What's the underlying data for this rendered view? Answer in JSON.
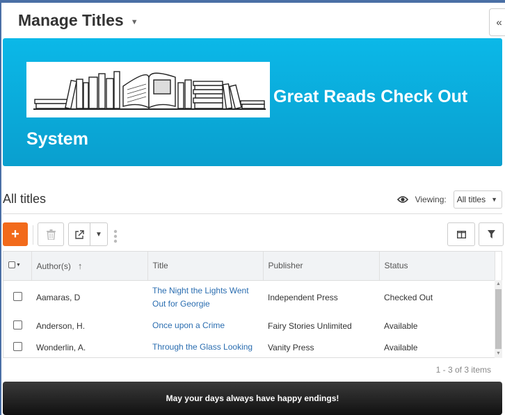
{
  "header": {
    "title": "Manage Titles"
  },
  "banner": {
    "text": "Great Reads Check Out System",
    "colors": {
      "background": "#0bb8e8"
    }
  },
  "list": {
    "title": "All titles",
    "viewing_label": "Viewing:",
    "viewing_value": "All titles"
  },
  "toolbar": {
    "add_label": "+",
    "colors": {
      "add_background": "#f26a1b"
    }
  },
  "grid": {
    "columns": [
      "Author(s)",
      "Title",
      "Publisher",
      "Status"
    ],
    "rows": [
      {
        "author": "Aamaras, D",
        "title": "The Night the Lights Went Out for Georgie",
        "publisher": "Independent Press",
        "status": "Checked Out"
      },
      {
        "author": "Anderson, H.",
        "title": "Once upon a Crime",
        "publisher": "Fairy Stories Unlimited",
        "status": "Available"
      },
      {
        "author": "Wonderlin, A.",
        "title": "Through the Glass Looking",
        "publisher": "Vanity Press",
        "status": "Available"
      }
    ]
  },
  "pager": {
    "info": "1 - 3 of 3 items"
  },
  "footer": {
    "text": "May your days always have happy endings!"
  }
}
